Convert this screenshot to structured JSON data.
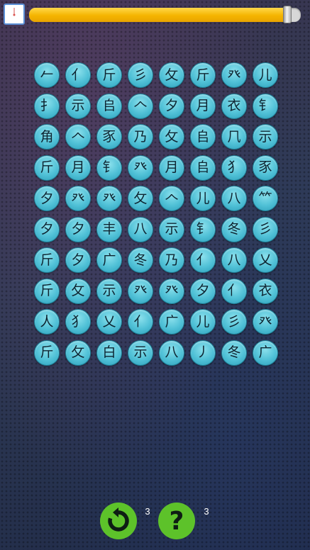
{
  "timer": {
    "remaining_fraction": 0.965
  },
  "board": {
    "rows": [
      [
        "𠂉",
        "亻",
        "斤",
        "彡",
        "攵",
        "斤",
        "癶",
        "儿"
      ],
      [
        "扌",
        "示",
        "𠂤",
        "𠆢",
        "夕",
        "月",
        "衣",
        "钅"
      ],
      [
        "⻆",
        "𠆢",
        "豕",
        "乃",
        "攵",
        "𠂤",
        "𠘨",
        "示"
      ],
      [
        "斤",
        "月",
        "钅",
        "癶",
        "月",
        "𠂤",
        "犭",
        "豕"
      ],
      [
        "夕",
        "癶",
        "癶",
        "攵",
        "𠆢",
        "儿",
        "八",
        "⺮"
      ],
      [
        "夕",
        "夕",
        "丰",
        "八",
        "示",
        "钅",
        "冬",
        "彡"
      ],
      [
        "斤",
        "夕",
        "广",
        "冬",
        "乃",
        "亻",
        "八",
        "乂"
      ],
      [
        "斤",
        "攵",
        "示",
        "癶",
        "癶",
        "夕",
        "亻",
        "衣"
      ],
      [
        "人",
        "犭",
        "乂",
        "亻",
        "广",
        "儿",
        "彡",
        "癶"
      ],
      [
        "斤",
        "攵",
        "白",
        "示",
        "八",
        "丿",
        "冬",
        "广"
      ]
    ]
  },
  "controls": {
    "refresh": {
      "icon": "refresh-icon",
      "count": "3"
    },
    "hint": {
      "icon": "question-mark-icon",
      "label": "?",
      "count": "3"
    }
  },
  "colors": {
    "timer_fill": "#f5b400",
    "tile": "#4fc0d6",
    "button": "#5dc22a"
  }
}
